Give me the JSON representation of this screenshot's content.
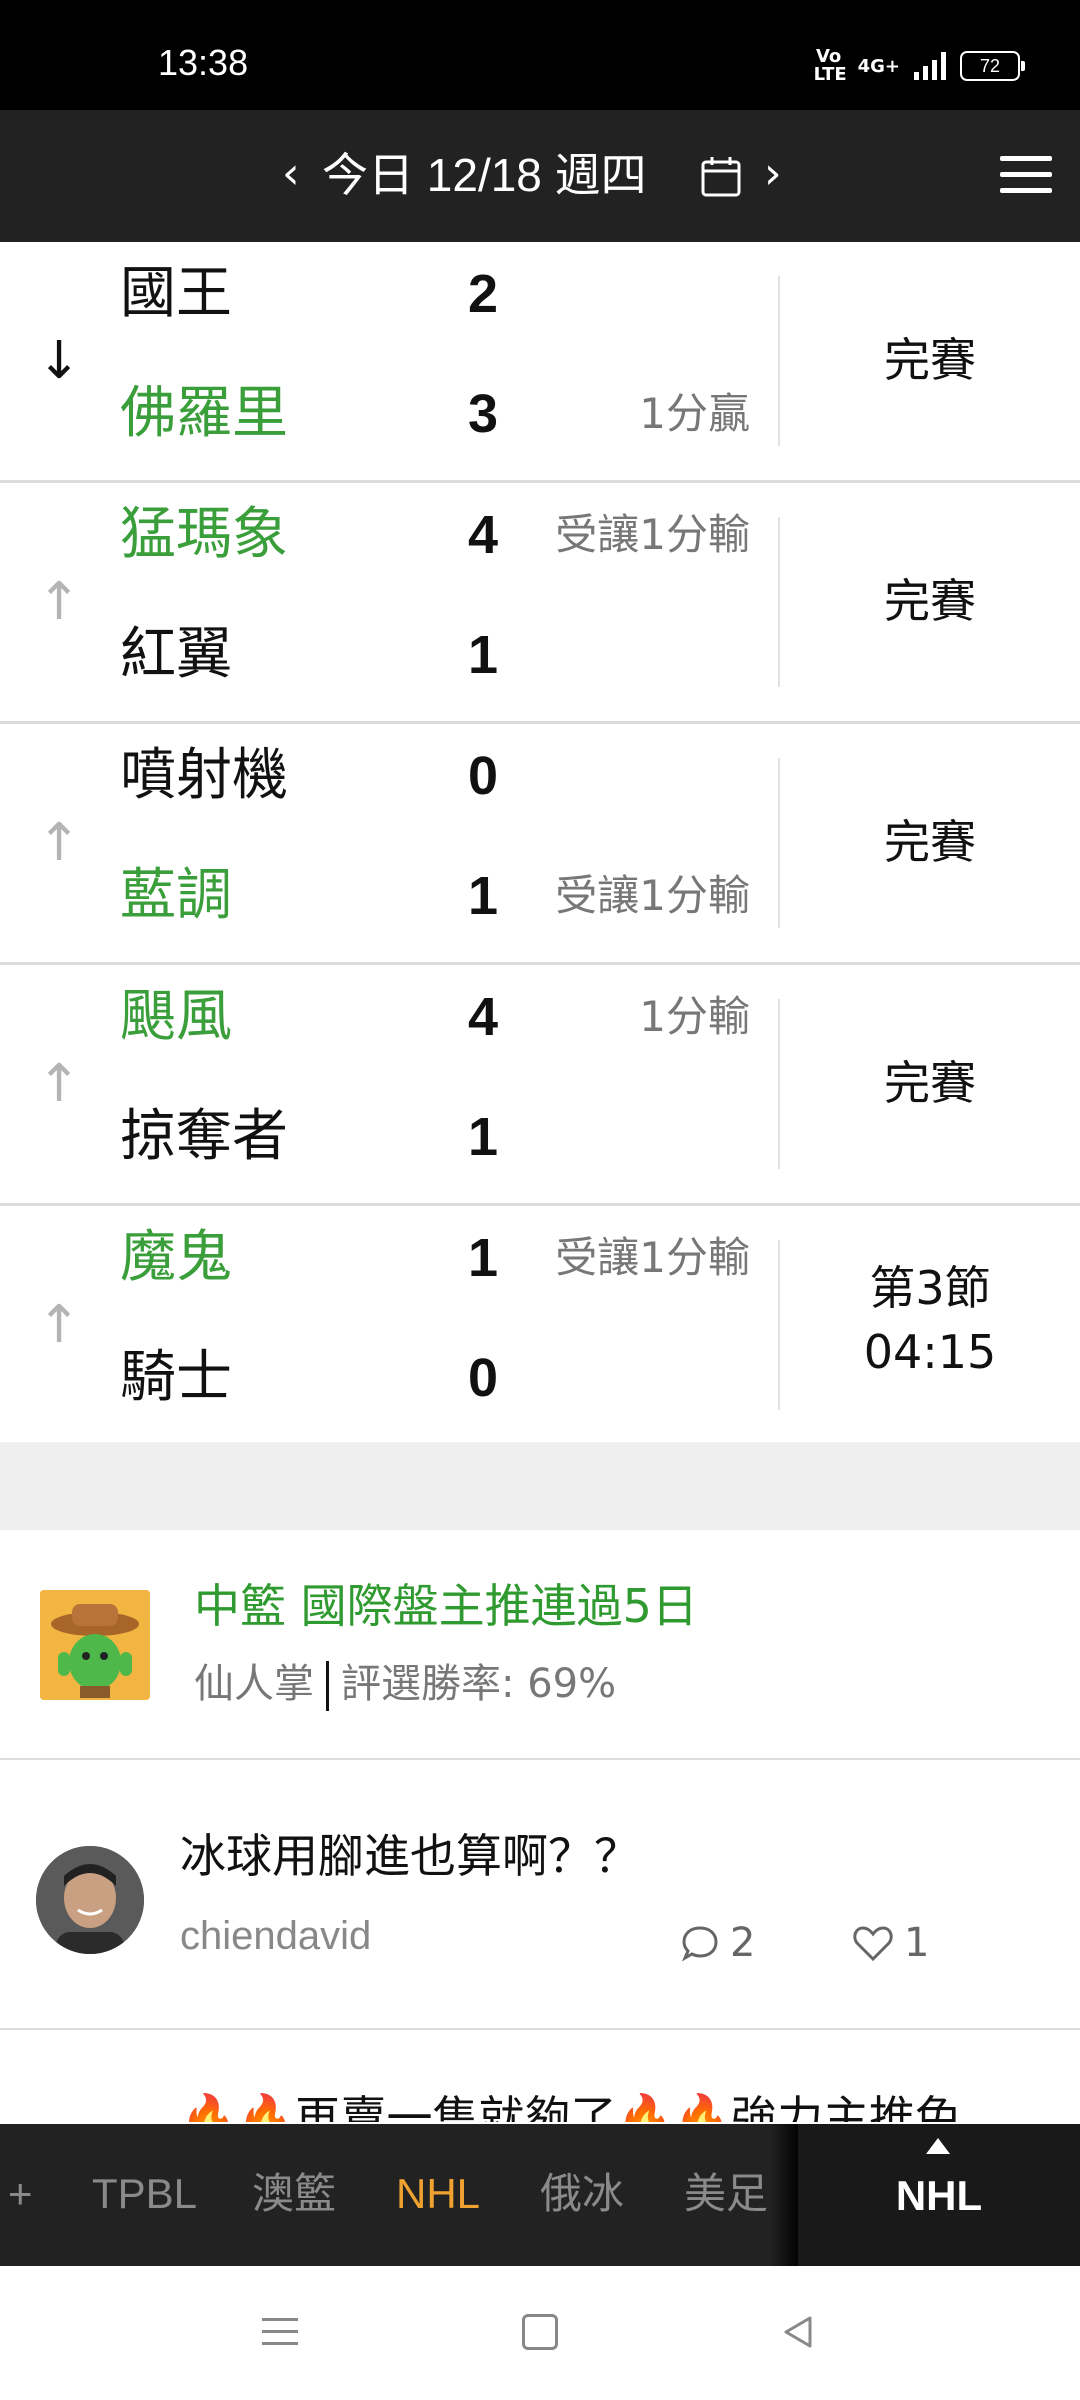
{
  "status_bar": {
    "time": "13:38",
    "network": "4G+",
    "volte": "Vo LTE",
    "battery": "72"
  },
  "top_nav": {
    "date_label": "今日 12/18 週四",
    "prev_glyph": "‹",
    "next_glyph": "›"
  },
  "games": [
    {
      "arrow": "↓",
      "arrow_style": "dark",
      "team1": {
        "name": "國王",
        "score": "2",
        "spread": "",
        "color": "black"
      },
      "team2": {
        "name": "佛羅里",
        "score": "3",
        "spread": "1分贏",
        "color": "green"
      },
      "status": [
        "完賽"
      ]
    },
    {
      "arrow": "↑",
      "arrow_style": "light",
      "team1": {
        "name": "猛瑪象",
        "score": "4",
        "spread": "受讓1分輸",
        "color": "green"
      },
      "team2": {
        "name": "紅翼",
        "score": "1",
        "spread": "",
        "color": "black"
      },
      "status": [
        "完賽"
      ]
    },
    {
      "arrow": "↑",
      "arrow_style": "light",
      "team1": {
        "name": "噴射機",
        "score": "0",
        "spread": "",
        "color": "black"
      },
      "team2": {
        "name": "藍調",
        "score": "1",
        "spread": "受讓1分輸",
        "color": "green"
      },
      "status": [
        "完賽"
      ]
    },
    {
      "arrow": "↑",
      "arrow_style": "light",
      "team1": {
        "name": "颶風",
        "score": "4",
        "spread": "1分輸",
        "color": "green"
      },
      "team2": {
        "name": "掠奪者",
        "score": "1",
        "spread": "",
        "color": "black"
      },
      "status": [
        "完賽"
      ]
    },
    {
      "arrow": "↑",
      "arrow_style": "light",
      "team1": {
        "name": "魔鬼",
        "score": "1",
        "spread": "受讓1分輸",
        "color": "green"
      },
      "team2": {
        "name": "騎士",
        "score": "0",
        "spread": "",
        "color": "black"
      },
      "status": [
        "第3節",
        "04:15"
      ]
    }
  ],
  "promo": {
    "title": "中籃 國際盤主推連過5日",
    "author": "仙人掌",
    "win_rate": "評選勝率: 69%"
  },
  "posts": [
    {
      "title": "冰球用腳進也算啊？？",
      "user": "chiendavid",
      "comments": "2",
      "likes": "1"
    },
    {
      "title": "🔥🔥再賣一隻就夠了🔥🔥強力主推兔"
    }
  ],
  "league_bar": {
    "tabs": [
      "+",
      "TPBL",
      "澳籃",
      "NHL",
      "俄冰",
      "美足"
    ],
    "active": "NHL",
    "current": "NHL"
  },
  "colors": {
    "green": "#3a9e3a",
    "accent": "#f0a230",
    "header": "#222222"
  }
}
